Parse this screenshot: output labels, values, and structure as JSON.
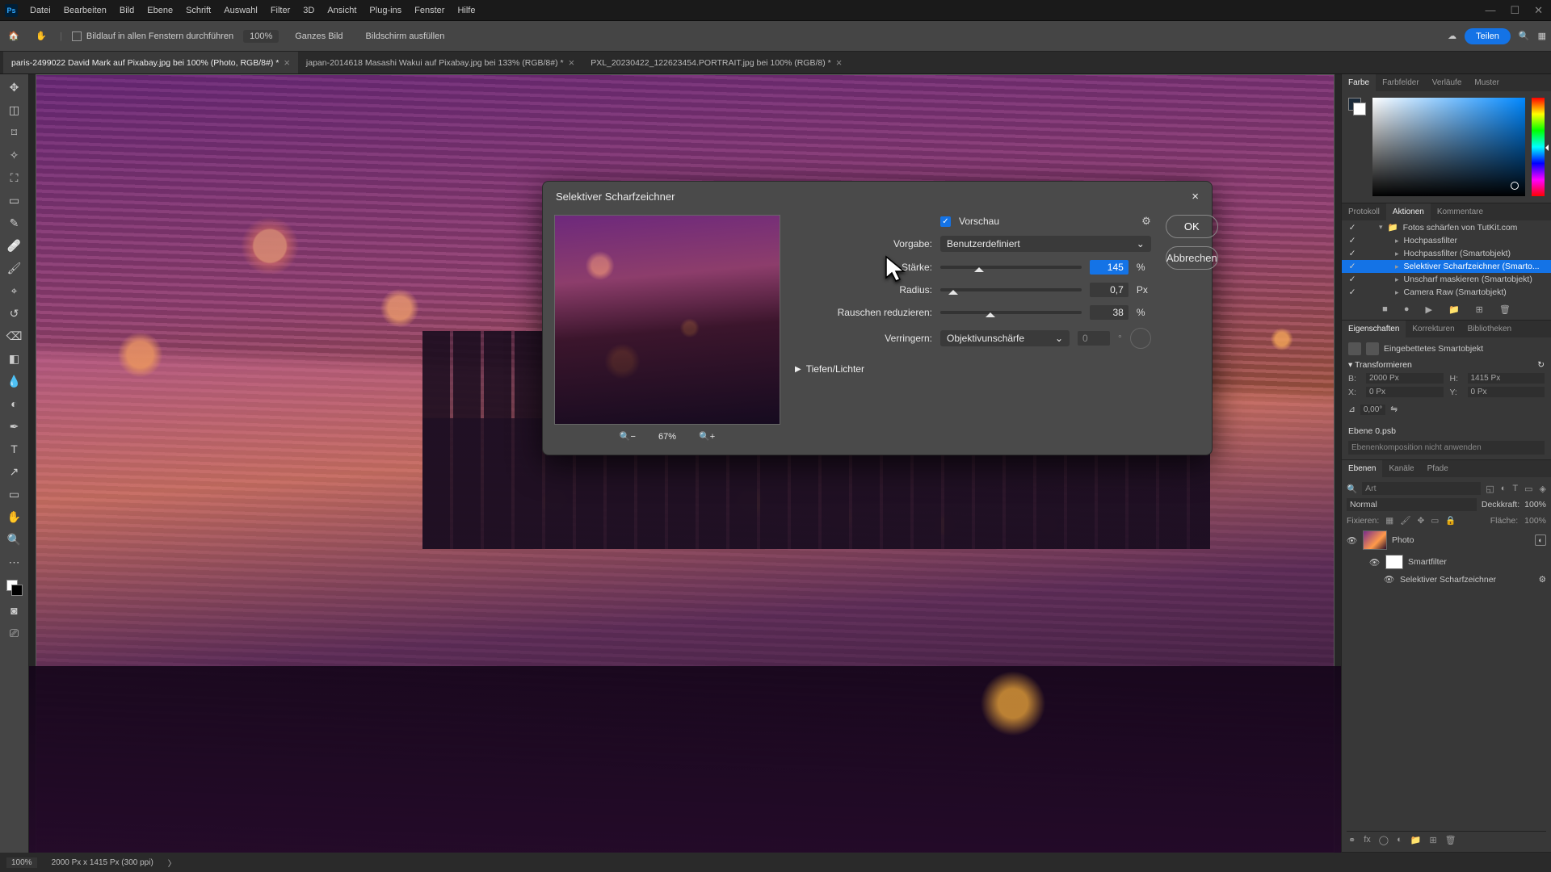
{
  "app": {
    "logo": "Ps"
  },
  "menu": [
    "Datei",
    "Bearbeiten",
    "Bild",
    "Ebene",
    "Schrift",
    "Auswahl",
    "Filter",
    "3D",
    "Ansicht",
    "Plug-ins",
    "Fenster",
    "Hilfe"
  ],
  "options": {
    "scrollAll": "Bildlauf in allen Fenstern durchführen",
    "zoom": "100%",
    "fitAll": "Ganzes Bild",
    "fitScreen": "Bildschirm ausfüllen",
    "share": "Teilen"
  },
  "tabs": [
    {
      "label": "paris-2499022  David Mark auf Pixabay.jpg bei 100% (Photo, RGB/8#) *",
      "active": true
    },
    {
      "label": "japan-2014618 Masashi Wakui auf Pixabay.jpg bei 133% (RGB/8#) *",
      "active": false
    },
    {
      "label": "PXL_20230422_122623454.PORTRAIT.jpg bei 100% (RGB/8) *",
      "active": false
    }
  ],
  "rightTabs": {
    "color": [
      "Farbe",
      "Farbfelder",
      "Verläufe",
      "Muster"
    ],
    "actions": [
      "Protokoll",
      "Aktionen",
      "Kommentare"
    ],
    "props": [
      "Eigenschaften",
      "Korrekturen",
      "Bibliotheken"
    ],
    "layers": [
      "Ebenen",
      "Kanäle",
      "Pfade"
    ]
  },
  "actions": {
    "set": "Fotos schärfen von TutKit.com",
    "items": [
      "Hochpassfilter",
      "Hochpassfilter (Smartobjekt)",
      "Selektiver Scharfzeichner (Smarto...",
      "Unscharf maskieren (Smartobjekt)",
      "Camera Raw (Smartobjekt)"
    ],
    "selectedIndex": 2
  },
  "properties": {
    "kind": "Eingebettetes Smartobjekt",
    "transform": "Transformieren",
    "B": "2000 Px",
    "H": "1415 Px",
    "X": "0 Px",
    "Y": "0 Px",
    "angle": "0,00°",
    "layerName": "Ebene 0.psb",
    "compBox": "Ebenenkomposition nicht anwenden"
  },
  "layers": {
    "searchPlaceholder": "Art",
    "blend": "Normal",
    "opacityLabel": "Deckkraft:",
    "opacity": "100%",
    "lockLabel": "Fixieren:",
    "fillLabel": "Fläche:",
    "fill": "100%",
    "photo": "Photo",
    "smartfilter": "Smartfilter",
    "filter": "Selektiver Scharfzeichner"
  },
  "status": {
    "zoom": "100%",
    "dims": "2000 Px x 1415 Px (300 ppi)"
  },
  "dialog": {
    "title": "Selektiver Scharfzeichner",
    "preview": "Vorschau",
    "presetLabel": "Vorgabe:",
    "preset": "Benutzerdefiniert",
    "amountLabel": "Stärke:",
    "amount": "145",
    "amountUnit": "%",
    "radiusLabel": "Radius:",
    "radius": "0,7",
    "radiusUnit": "Px",
    "noiseLabel": "Rauschen reduzieren:",
    "noise": "38",
    "noiseUnit": "%",
    "removeLabel": "Verringern:",
    "remove": "Objektivunschärfe",
    "removeVal": "0",
    "removeDeg": "°",
    "section": "Tiefen/Lichter",
    "ok": "OK",
    "cancel": "Abbrechen",
    "zoom": "67%"
  }
}
